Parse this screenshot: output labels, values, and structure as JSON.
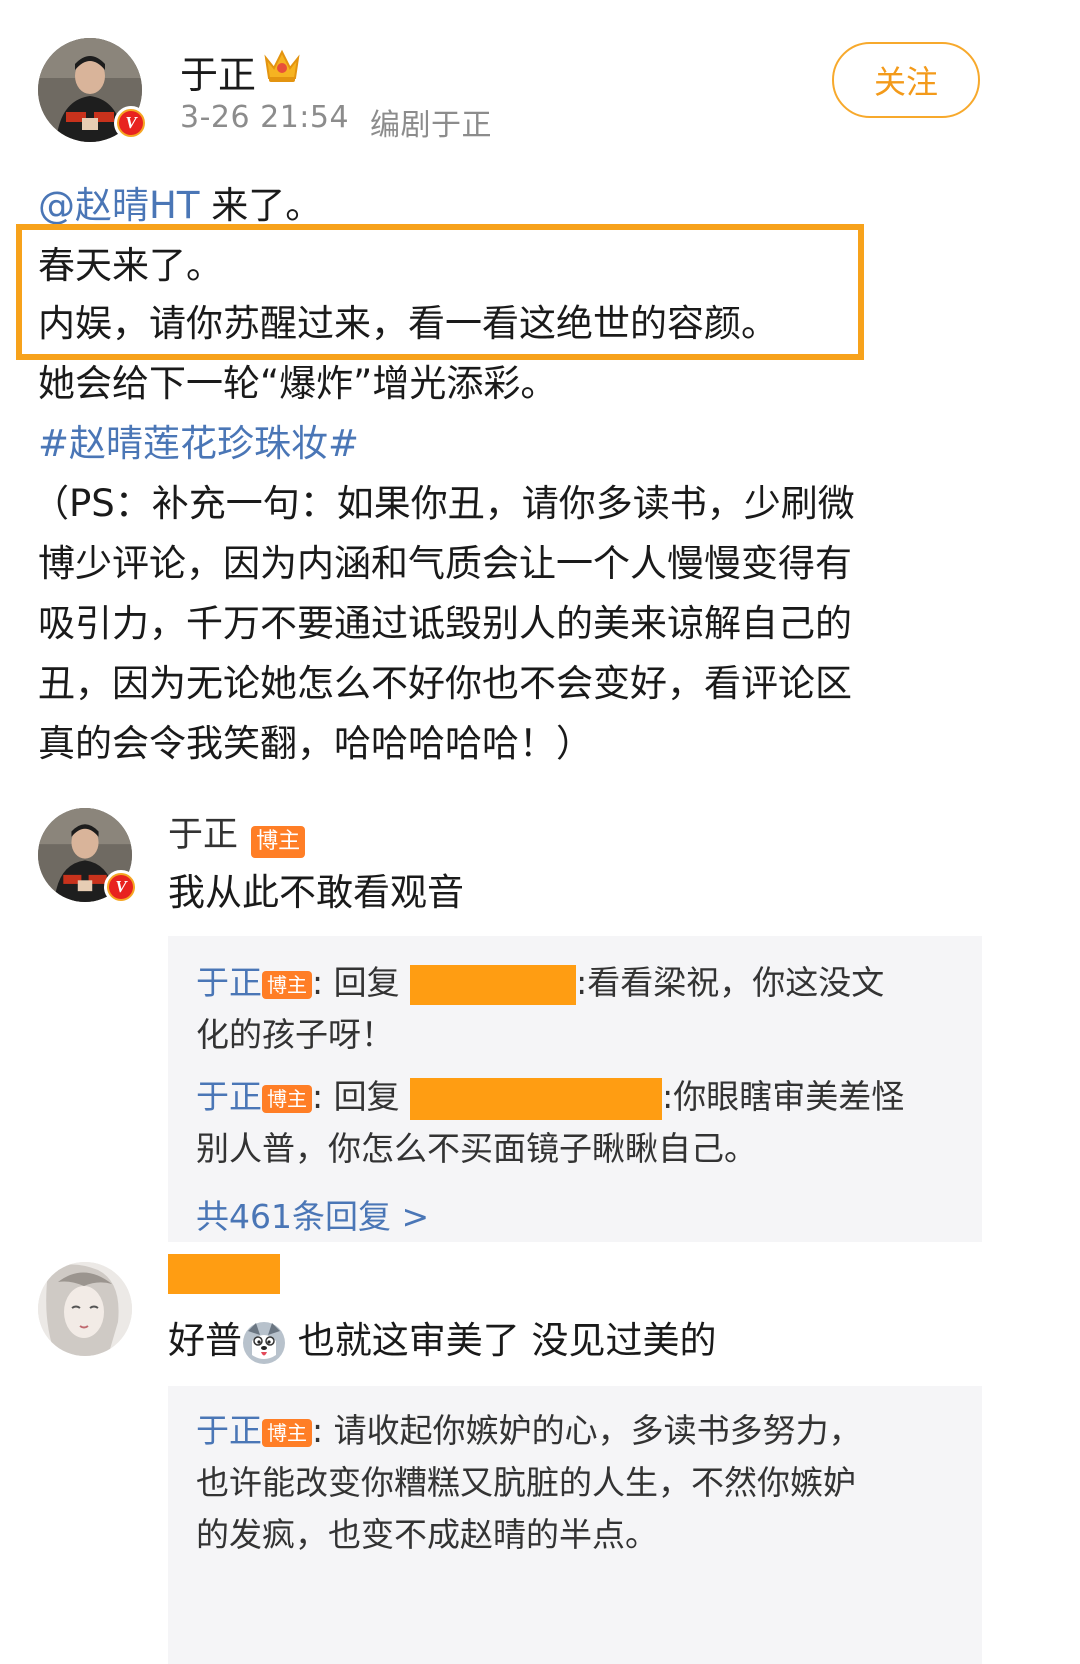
{
  "post": {
    "author": "于正",
    "timestamp": "3-26 21:54",
    "source": "编剧于正",
    "follow_label": "关注",
    "mention": "@赵晴HT",
    "line1_rest": " 来了。",
    "line2": "春天来了。",
    "line3": "内娱，请你苏醒过来，看一看这绝世的容颜。",
    "line4": "她会给下一轮“爆炸”增光添彩。",
    "hashtag": "#赵晴莲花珍珠妆#",
    "ps_lines": [
      "（PS：补充一句：如果你丑，请你多读书，少刷微",
      "博少评论，因为内涵和气质会让一个人慢慢变得有",
      "吸引力，千万不要通过诋毁别人的美来谅解自己的",
      "丑，因为无论她怎么不好你也不会变好，看评论区",
      "真的会令我笑翻，哈哈哈哈哈！）"
    ],
    "highlight_color": "#f7a21b",
    "link_color": "#4a76b6"
  },
  "comments": [
    {
      "name": "于正",
      "badge": "博主",
      "text": "我从此不敢看观音",
      "replies": [
        {
          "name": "于正",
          "badge": "博主",
          "prefix": ": 回复 ",
          "text": ":看看梁祝，你这没文",
          "text2": "化的孩子呀！"
        },
        {
          "name": "于正",
          "badge": "博主",
          "prefix": ": 回复 ",
          "text": ":你眼瞎审美差怪",
          "text2": "别人普，你怎么不买面镜子瞅瞅自己。"
        }
      ],
      "more_replies": "共461条回复 >"
    },
    {
      "name": "",
      "text_a": "好普",
      "text_b": " 也就这审美了 没见过美的",
      "replies": [
        {
          "name": "于正",
          "badge": "博主",
          "line1": ": 请收起你嫉妒的心，多读书多努力，",
          "line2": "也许能改变你糟糕又肮脏的人生，不然你嫉妒",
          "line3": "的发疯，也变不成赵晴的半点。"
        }
      ]
    }
  ],
  "icons": {
    "verified": "verified-v-icon",
    "crown": "crown-icon",
    "emoji": "husky-emoji-icon"
  },
  "colors": {
    "accent": "#f39a1a",
    "redaction": "#ff9d12",
    "badge": "#ff7e26",
    "reply_bg": "#f5f5f7"
  }
}
